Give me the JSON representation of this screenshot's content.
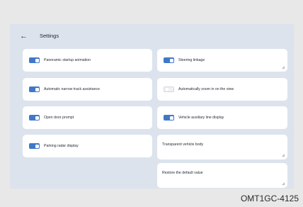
{
  "header": {
    "back_icon": "←",
    "title": "Settings"
  },
  "left_settings": [
    {
      "label": "Panoramic startup animation",
      "toggle": "on"
    },
    {
      "label": "Automatic narrow track assistance",
      "toggle": "on"
    },
    {
      "label": "Open door prompt",
      "toggle": "on"
    },
    {
      "label": "Parking radar display",
      "toggle": "on"
    }
  ],
  "right_settings": [
    {
      "label": "Steering linkage",
      "toggle": "on"
    },
    {
      "label": "Automatically zoom in on the view",
      "toggle": "off"
    },
    {
      "label": "Vehicle auxiliary line display",
      "toggle": "on"
    },
    {
      "label": "Transparent vehicle body",
      "toggle": "none"
    },
    {
      "label": "Restore the default value",
      "toggle": "none"
    }
  ],
  "watermark": "OMT1GC-4125",
  "colors": {
    "accent": "#3f78c8",
    "panel_background": "#dce3ed",
    "card_background": "#ffffff"
  }
}
